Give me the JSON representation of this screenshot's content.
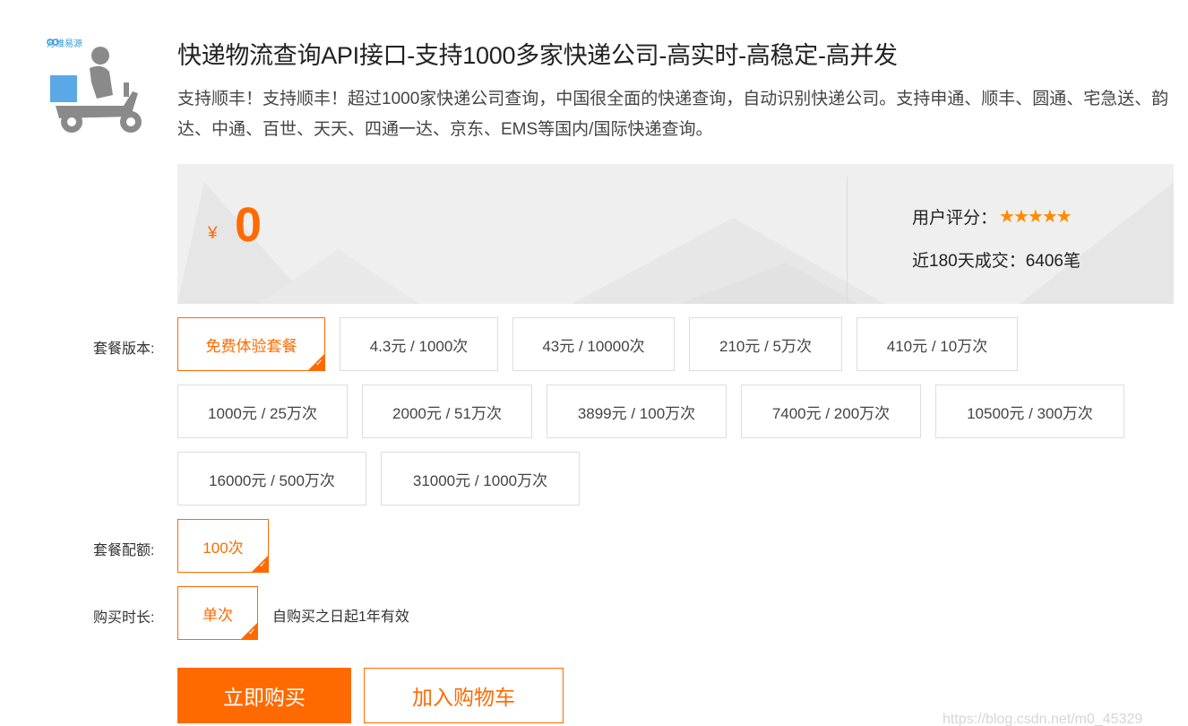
{
  "product": {
    "brand_logo_text": "万维易源",
    "title": "快递物流查询API接口-支持1000多家快递公司-高实时-高稳定-高并发",
    "description": "支持顺丰！支持顺丰！超过1000家快递公司查询，中国很全面的快递查询，自动识别快递公司。支持申通、顺丰、圆通、宅急送、韵达、中通、百世、天天、四通一达、京东、EMS等国内/国际快递查询。"
  },
  "pricing": {
    "currency": "¥",
    "price": "0",
    "rating_label": "用户评分：",
    "rating_stars": 5,
    "sales_label": "近180天成交：6406笔"
  },
  "package_version": {
    "label": "套餐版本:",
    "options": [
      "免费体验套餐",
      "4.3元 / 1000次",
      "43元 / 10000次",
      "210元 / 5万次",
      "410元 / 10万次",
      "1000元 / 25万次",
      "2000元 / 51万次",
      "3899元 / 100万次",
      "7400元 / 200万次",
      "10500元 / 300万次",
      "16000元 / 500万次",
      "31000元 / 1000万次"
    ],
    "selected": "免费体验套餐"
  },
  "package_quota": {
    "label": "套餐配额:",
    "options": [
      "100次"
    ],
    "selected": "100次"
  },
  "purchase_duration": {
    "label": "购买时长:",
    "options": [
      "单次"
    ],
    "selected": "单次",
    "note": "自购买之日起1年有效"
  },
  "actions": {
    "buy_now": "立即购买",
    "add_to_cart": "加入购物车"
  },
  "watermark": "https://blog.csdn.net/m0_45329",
  "colors": {
    "accent": "#ff6a00",
    "star": "#ff8a00",
    "panel_bg": "#efefef",
    "icon_fill": "#888888",
    "icon_box": "#5aa9e6"
  }
}
